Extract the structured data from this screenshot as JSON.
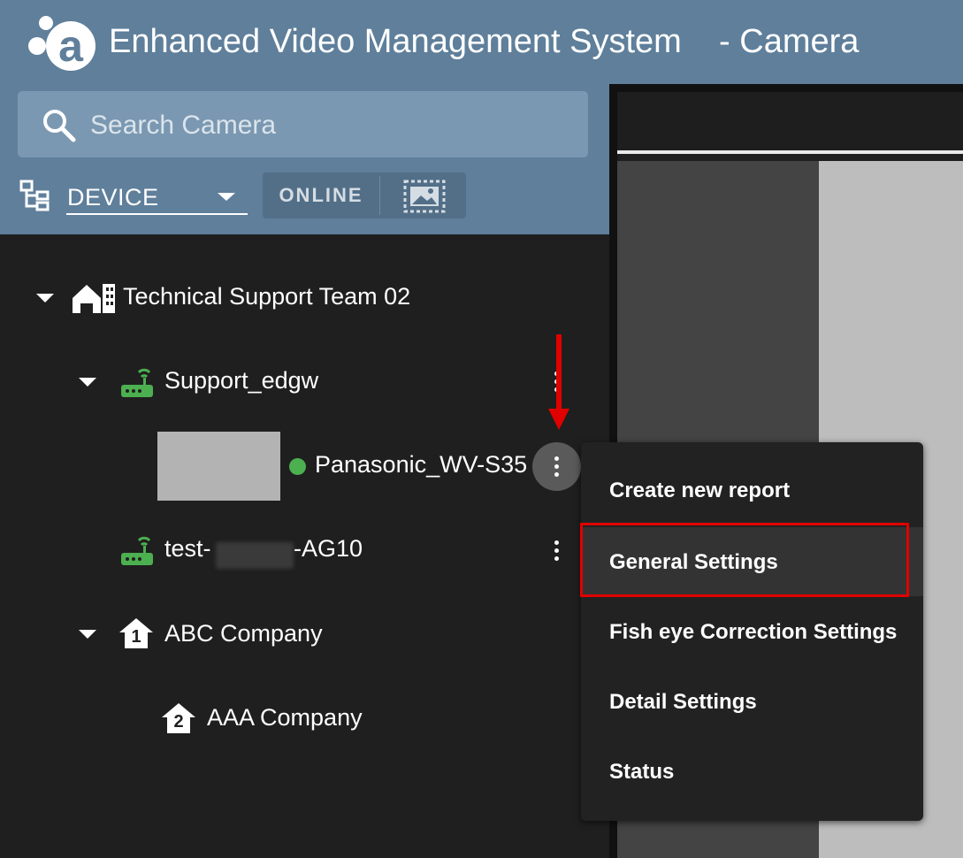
{
  "header": {
    "title": "Enhanced Video Management System    - Camera"
  },
  "search": {
    "placeholder": "Search Camera",
    "icon": "search-icon"
  },
  "filters": {
    "view_mode": "DEVICE",
    "online_label": "ONLINE"
  },
  "tree": {
    "group": "Technical Support Team 02",
    "gateway1": "Support_edgw",
    "camera1": "Panasonic_WV-S35",
    "gateway2_prefix": "test-",
    "gateway2_suffix": "-AG10",
    "company1": "ABC Company",
    "company1_badge": "1",
    "company2": "AAA Company",
    "company2_badge": "2"
  },
  "context_menu": {
    "items": [
      "Create new report",
      "General Settings",
      "Fish eye Correction Settings",
      "Detail Settings",
      "Status"
    ],
    "highlighted": "General Settings"
  },
  "colors": {
    "header_bg": "#5f7f9b",
    "tree_bg": "#1f1f1f",
    "online_status": "#4caf50",
    "router_green": "#4caf50",
    "annotation_red": "#e00000"
  }
}
